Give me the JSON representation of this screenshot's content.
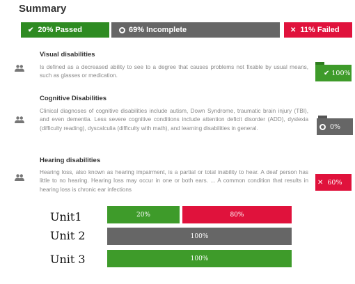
{
  "header": {
    "title": "Summary"
  },
  "summary": {
    "passed_label": "20% Passed",
    "incomplete_label": "69% Incomplete",
    "failed_label": "11% Failed",
    "colors": {
      "passed": "#2e8b22",
      "incomplete": "#666666",
      "failed": "#e0123c"
    }
  },
  "items": [
    {
      "title": "Visual disabilities",
      "desc": "Is defined as a decreased ability to see to a degree that causes problems not fixable by usual means, such as glasses or medication.",
      "badge": "100%",
      "status": "passed",
      "icon": "people-icon"
    },
    {
      "title": "Cognitive Disabilities",
      "desc": "Clinical diagnoses of cognitive disabilities include autism, Down Syndrome, traumatic brain injury (TBI), and even dementia. Less severe cognitive conditions include attention deficit disorder (ADD), dyslexia (difficulty reading), dyscalculia (difficulty with math), and learning disabilities in general.",
      "badge": "0%",
      "status": "incomplete",
      "icon": "people-icon"
    },
    {
      "title": "Hearing disabilities",
      "desc": "Hearing loss, also known as hearing impairment, is a partial or total inability to hear. A deaf person has little to no hearing. Hearing loss may occur in one or both ears. ... A common condition that results in hearing loss is chronic ear infections",
      "badge": "60%",
      "status": "failed",
      "icon": "people-icon"
    }
  ],
  "units": [
    {
      "label": "Unit1",
      "segments": [
        {
          "text": "20%",
          "fraction": 0.2,
          "color": "#3e9b2a"
        },
        {
          "text": "80%",
          "fraction": 0.8,
          "color": "#e0123c"
        }
      ]
    },
    {
      "label": "Unit 2",
      "segments": [
        {
          "text": "100%",
          "fraction": 1.0,
          "color": "#666666"
        }
      ]
    },
    {
      "label": "Unit 3",
      "segments": [
        {
          "text": "100%",
          "fraction": 1.0,
          "color": "#3e9b2a"
        }
      ]
    }
  ]
}
